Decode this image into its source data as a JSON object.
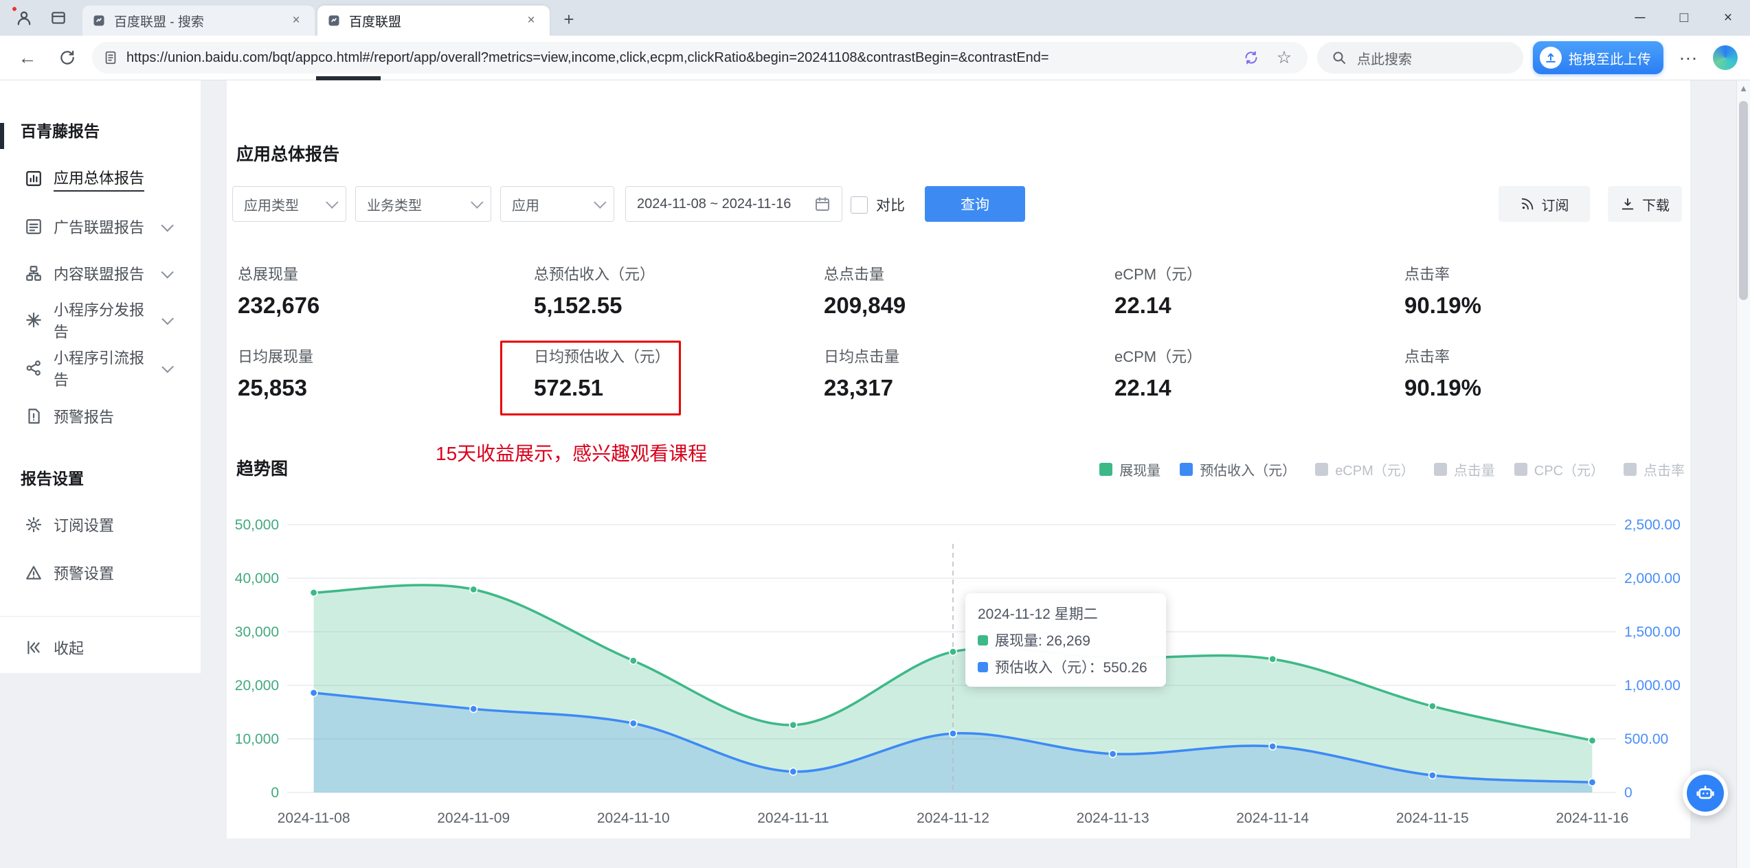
{
  "browser": {
    "tabs": [
      {
        "title": "百度联盟 - 搜索"
      },
      {
        "title": "百度联盟",
        "active": true
      }
    ],
    "url": "https://union.baidu.com/bqt/appco.html#/report/app/overall?metrics=view,income,click,ecpm,clickRatio&begin=20241108&contrastBegin=&contrastEnd=",
    "search_placeholder": "点此搜索",
    "upload_button": "拖拽至此上传",
    "icons": {
      "back": "←",
      "star": "☆",
      "more": "···",
      "minimize": "─",
      "maximize": "□",
      "close": "×",
      "new_tab": "+",
      "tab_close": "×",
      "scroll_up": "▲"
    }
  },
  "sidebar": {
    "section1_title": "百青藤报告",
    "items": [
      {
        "label": "应用总体报告",
        "active": true
      },
      {
        "label": "广告联盟报告",
        "expandable": true
      },
      {
        "label": "内容联盟报告",
        "expandable": true
      },
      {
        "label": "小程序分发报告",
        "expandable": true
      },
      {
        "label": "小程序引流报告",
        "expandable": true
      },
      {
        "label": "预警报告"
      }
    ],
    "section2_title": "报告设置",
    "settings_items": [
      {
        "label": "订阅设置"
      },
      {
        "label": "预警设置"
      }
    ],
    "collapse_label": "收起"
  },
  "main": {
    "title": "应用总体报告",
    "filters": {
      "app_type": "应用类型",
      "business_type": "业务类型",
      "app": "应用",
      "date_range": "2024-11-08 ~ 2024-11-16",
      "compare_label": "对比",
      "query_button": "查询",
      "subscribe_button": "订阅",
      "download_button": "下载"
    },
    "stats": {
      "row1": [
        {
          "label": "总展现量",
          "value": "232,676"
        },
        {
          "label": "总预估收入（元）",
          "value": "5,152.55"
        },
        {
          "label": "总点击量",
          "value": "209,849"
        },
        {
          "label": "eCPM（元）",
          "value": "22.14"
        },
        {
          "label": "点击率",
          "value": "90.19%"
        }
      ],
      "row2": [
        {
          "label": "日均展现量",
          "value": "25,853"
        },
        {
          "label": "日均预估收入（元）",
          "value": "572.51",
          "highlighted": true
        },
        {
          "label": "日均点击量",
          "value": "23,317"
        },
        {
          "label": "eCPM（元）",
          "value": "22.14"
        },
        {
          "label": "点击率",
          "value": "90.19%"
        }
      ]
    },
    "annotation": "15天收益展示，感兴趣观看课程",
    "annotation_color": "#d9001b",
    "chart_title": "趋势图",
    "tooltip": {
      "title": "2024-11-12 星期二",
      "rows": [
        {
          "color": "#3db987",
          "text": "展现量: 26,269"
        },
        {
          "color": "#3d8af5",
          "text": "预估收入（元）：550.26"
        }
      ]
    }
  },
  "chart_data": {
    "type": "area",
    "title": "趋势图",
    "x": [
      "2024-11-08",
      "2024-11-09",
      "2024-11-10",
      "2024-11-11",
      "2024-11-12",
      "2024-11-13",
      "2024-11-14",
      "2024-11-15",
      "2024-11-16"
    ],
    "series": [
      {
        "name": "展现量",
        "axis": "left",
        "color": "#3db987",
        "fill": "rgba(61,185,135,0.25)",
        "values": [
          37300,
          37900,
          24600,
          12600,
          26269,
          25100,
          24900,
          16100,
          9700
        ]
      },
      {
        "name": "预估收入（元）",
        "axis": "right",
        "color": "#3d8af5",
        "fill": "rgba(61,138,245,0.22)",
        "values": [
          930,
          780,
          645,
          195,
          550.26,
          360,
          430,
          160,
          95
        ]
      }
    ],
    "left_axis": {
      "min": 0,
      "max": 50000,
      "color": "#43a97f",
      "ticks": [
        "0",
        "10,000",
        "20,000",
        "30,000",
        "40,000",
        "50,000"
      ]
    },
    "right_axis": {
      "min": 0,
      "max": 2500,
      "color": "#4a8ef7",
      "ticks": [
        "0",
        "500.00",
        "1,000.00",
        "1,500.00",
        "2,000.00",
        "2,500.00"
      ]
    },
    "legend": [
      {
        "label": "展现量",
        "color": "#3db987",
        "enabled": true
      },
      {
        "label": "预估收入（元）",
        "color": "#3d8af5",
        "enabled": true
      },
      {
        "label": "eCPM（元）",
        "color": "#c9ced6",
        "enabled": false
      },
      {
        "label": "点击量",
        "color": "#c9ced6",
        "enabled": false
      },
      {
        "label": "CPC（元）",
        "color": "#c9ced6",
        "enabled": false
      },
      {
        "label": "点击率",
        "color": "#c9ced6",
        "enabled": false
      }
    ],
    "tooltip_index": 4,
    "grid": true,
    "legend_position": "top-right"
  }
}
